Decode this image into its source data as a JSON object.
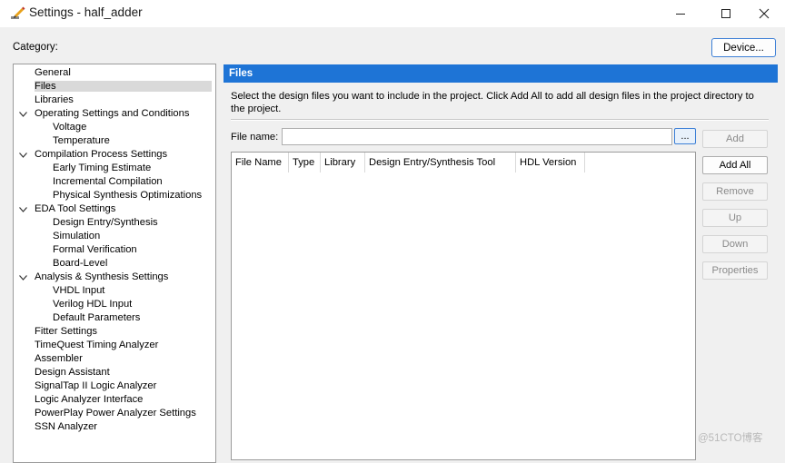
{
  "window": {
    "title": "Settings - half_adder",
    "icon": "settings-pencil-icon",
    "controls": [
      "minimize-icon",
      "maximize-icon",
      "close-icon"
    ]
  },
  "category_label": "Category:",
  "device_button": "Device...",
  "tree": {
    "selected": "Files",
    "items": [
      {
        "label": "General",
        "level": 0,
        "expandable": false
      },
      {
        "label": "Files",
        "level": 0,
        "expandable": false
      },
      {
        "label": "Libraries",
        "level": 0,
        "expandable": false
      },
      {
        "label": "Operating Settings and Conditions",
        "level": 0,
        "expandable": true
      },
      {
        "label": "Voltage",
        "level": 1,
        "expandable": false
      },
      {
        "label": "Temperature",
        "level": 1,
        "expandable": false
      },
      {
        "label": "Compilation Process Settings",
        "level": 0,
        "expandable": true
      },
      {
        "label": "Early Timing Estimate",
        "level": 1,
        "expandable": false
      },
      {
        "label": "Incremental Compilation",
        "level": 1,
        "expandable": false
      },
      {
        "label": "Physical Synthesis Optimizations",
        "level": 1,
        "expandable": false
      },
      {
        "label": "EDA Tool Settings",
        "level": 0,
        "expandable": true
      },
      {
        "label": "Design Entry/Synthesis",
        "level": 1,
        "expandable": false
      },
      {
        "label": "Simulation",
        "level": 1,
        "expandable": false
      },
      {
        "label": "Formal Verification",
        "level": 1,
        "expandable": false
      },
      {
        "label": "Board-Level",
        "level": 1,
        "expandable": false
      },
      {
        "label": "Analysis & Synthesis Settings",
        "level": 0,
        "expandable": true
      },
      {
        "label": "VHDL Input",
        "level": 1,
        "expandable": false
      },
      {
        "label": "Verilog HDL Input",
        "level": 1,
        "expandable": false
      },
      {
        "label": "Default Parameters",
        "level": 1,
        "expandable": false
      },
      {
        "label": "Fitter Settings",
        "level": 0,
        "expandable": false
      },
      {
        "label": "TimeQuest Timing Analyzer",
        "level": 0,
        "expandable": false
      },
      {
        "label": "Assembler",
        "level": 0,
        "expandable": false
      },
      {
        "label": "Design Assistant",
        "level": 0,
        "expandable": false
      },
      {
        "label": "SignalTap II Logic Analyzer",
        "level": 0,
        "expandable": false
      },
      {
        "label": "Logic Analyzer Interface",
        "level": 0,
        "expandable": false
      },
      {
        "label": "PowerPlay Power Analyzer Settings",
        "level": 0,
        "expandable": false
      },
      {
        "label": "SSN Analyzer",
        "level": 0,
        "expandable": false
      }
    ]
  },
  "panel": {
    "header": "Files",
    "description": "Select the design files you want to include in the project. Click Add All to add all design files in the project directory to the project.",
    "file_name_label": "File name:",
    "file_name_value": "",
    "browse_label": "...",
    "table_columns": [
      "File Name",
      "Type",
      "Library",
      "Design Entry/Synthesis Tool",
      "HDL Version"
    ],
    "rows": []
  },
  "buttons": [
    {
      "label": "Add",
      "enabled": false
    },
    {
      "label": "Add All",
      "enabled": true
    },
    {
      "label": "Remove",
      "enabled": false
    },
    {
      "label": "Up",
      "enabled": false
    },
    {
      "label": "Down",
      "enabled": false
    },
    {
      "label": "Properties",
      "enabled": false
    }
  ],
  "colors": {
    "header_blue": "#1e74d6",
    "selection": "#d9d9d9",
    "focus_border": "#3c7fd6"
  },
  "watermark": "@51CTO博客"
}
